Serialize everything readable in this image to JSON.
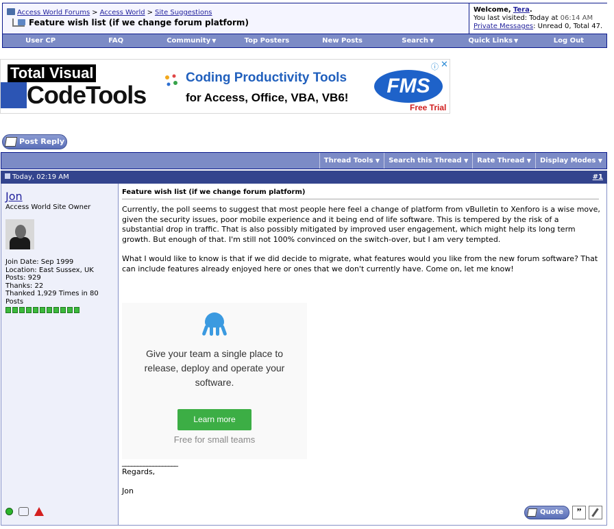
{
  "breadcrumb": {
    "items": [
      "Access World Forums",
      "Access World",
      "Site Suggestions"
    ],
    "separator": ">"
  },
  "thread_title": "Feature wish list (if we change forum platform)",
  "welcome": {
    "label": "Welcome,",
    "username": "Tera",
    "last_visited_label": "You last visited: Today at",
    "last_visited_time": "06:14 AM",
    "pm_link": "Private Messages",
    "pm_status": ": Unread 0, Total 47."
  },
  "nav": {
    "items": [
      {
        "label": "User CP",
        "dropdown": false
      },
      {
        "label": "FAQ",
        "dropdown": false
      },
      {
        "label": "Community",
        "dropdown": true
      },
      {
        "label": "Top Posters",
        "dropdown": false
      },
      {
        "label": "New Posts",
        "dropdown": false
      },
      {
        "label": "Search",
        "dropdown": true
      },
      {
        "label": "Quick Links",
        "dropdown": true
      },
      {
        "label": "Log Out",
        "dropdown": false
      }
    ]
  },
  "ad_banner": {
    "brand_top": "Total Visual",
    "brand_bottom": "CodeTools",
    "headline": "Coding Productivity Tools",
    "subline": "for Access, Office, VBA, VB6!",
    "fms": "FMS",
    "trial": "Free Trial"
  },
  "post_reply_label": "Post Reply",
  "thread_tools": [
    {
      "label": "Thread Tools"
    },
    {
      "label": "Search this Thread"
    },
    {
      "label": "Rate Thread"
    },
    {
      "label": "Display Modes"
    }
  ],
  "post": {
    "date": "Today, 02:19 AM",
    "number": "#1",
    "author": {
      "name": "Jon",
      "title": "Access World Site Owner",
      "join_date": "Join Date: Sep 1999",
      "location": "Location: East Sussex, UK",
      "posts": "Posts: 929",
      "thanks": "Thanks: 22",
      "thanked": "Thanked 1,929 Times in 80 Posts",
      "reputation_pips": 11
    },
    "title": "Feature wish list (if we change forum platform)",
    "paragraph_1": "Currently, the poll seems to suggest that most people here feel a change of platform from vBulletin to Xenforo is a wise move, given the security issues, poor mobile experience and it being end of life software. This is tempered by the risk of a substantial drop in traffic. That is also possibly mitigated by improved user engagement, which might help its long term growth. But enough of that. I'm still not 100% convinced on the switch-over, but I am very tempted.",
    "paragraph_2": "What I would like to know is that if we did decide to migrate, what features would you like from the new forum software? That can include features already enjoyed here or ones that we don't currently have. Come on, let me know!",
    "inline_ad": {
      "text": "Give your team a single place to release, deploy and operate your software.",
      "button": "Learn more",
      "footer": "Free for small teams"
    },
    "signature": {
      "line": "__________________",
      "regards": "Regards,",
      "name": "Jon"
    },
    "quote_label": "Quote"
  },
  "colors": {
    "nav_bg": "#7c8bc6",
    "post_header_bg": "#33448d",
    "userbox_bg": "#eef0fa",
    "reputation": "#3cb93c"
  }
}
